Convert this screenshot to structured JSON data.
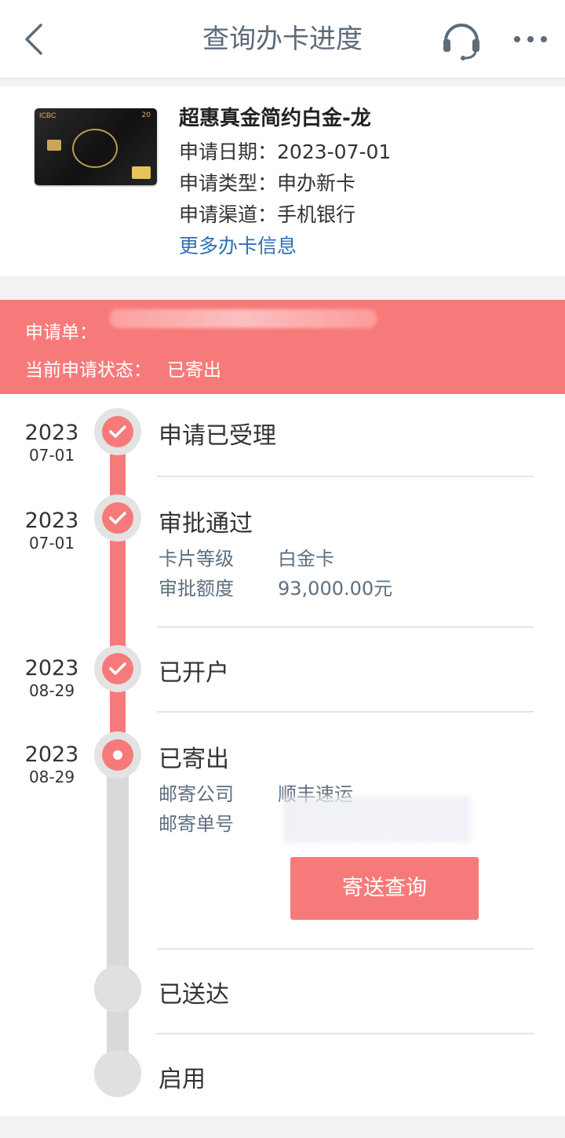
{
  "header": {
    "title": "查询办卡进度"
  },
  "card": {
    "name": "超惠真金简约白金-龙",
    "brand_text": "ICBC",
    "badge_text": "20",
    "apply_date_label": "申请日期：",
    "apply_date": "2023-07-01",
    "apply_type_label": "申请类型：",
    "apply_type": "申办新卡",
    "apply_channel_label": "申请渠道：",
    "apply_channel": "手机银行",
    "more_info_link": "更多办卡信息"
  },
  "status": {
    "application_label": "申请单：",
    "current_status_label": "当前申请状态：",
    "current_status": "已寄出",
    "color": "#f77a7a"
  },
  "timeline": {
    "steps": [
      {
        "year": "2023",
        "date": "07-01",
        "title": "申请已受理",
        "state": "done"
      },
      {
        "year": "2023",
        "date": "07-01",
        "title": "审批通过",
        "state": "done",
        "details": [
          {
            "label": "卡片等级",
            "value": "白金卡"
          },
          {
            "label": "审批额度",
            "value": "93,000.00元"
          }
        ]
      },
      {
        "year": "2023",
        "date": "08-29",
        "title": "已开户",
        "state": "done"
      },
      {
        "year": "2023",
        "date": "08-29",
        "title": "已寄出",
        "state": "current",
        "details": [
          {
            "label": "邮寄公司",
            "value": "顺丰速运"
          },
          {
            "label": "邮寄单号",
            "value": ""
          }
        ],
        "button": "寄送查询"
      },
      {
        "year": "",
        "date": "",
        "title": "已送达",
        "state": "pending"
      },
      {
        "year": "",
        "date": "",
        "title": "启用",
        "state": "pending"
      }
    ]
  },
  "icons": {
    "back": "chevron-left-icon",
    "support": "headset-icon",
    "more": "more-dots-icon",
    "check": "check-icon"
  }
}
